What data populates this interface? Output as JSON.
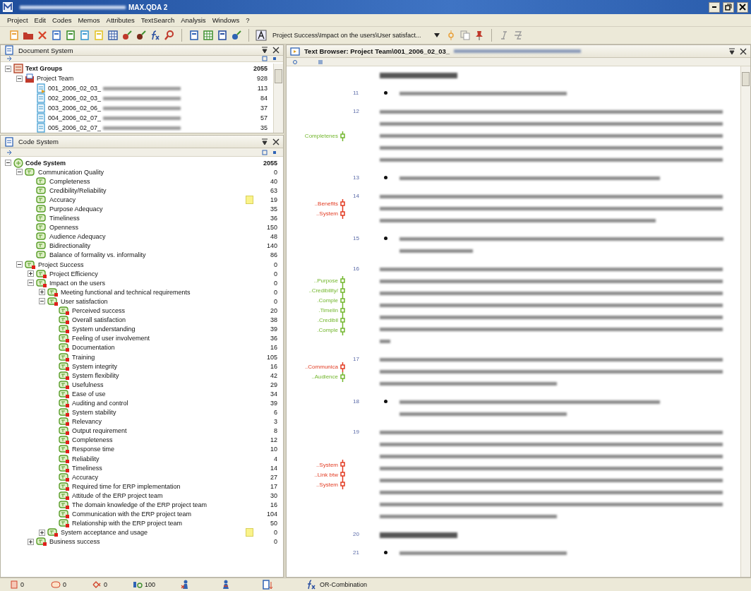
{
  "window": {
    "title": "MAX.QDA 2",
    "title_redacted": true
  },
  "menu": [
    "Project",
    "Edit",
    "Codes",
    "Memos",
    "Attributes",
    "TextSearch",
    "Analysis",
    "Windows",
    "?"
  ],
  "toolbar": {
    "code_path": "Project Success\\Impact on the users\\User satisfact..."
  },
  "document_system": {
    "title": "Document System",
    "nodes": [
      {
        "kind": "root",
        "label": "Text Groups",
        "count": "2055",
        "expanded": true,
        "children": [
          {
            "kind": "group",
            "label": "Project Team",
            "count": "928",
            "expanded": true,
            "children": [
              {
                "kind": "document",
                "label": "001_2006_02_03_",
                "count": "113",
                "active": true,
                "redacted": true
              },
              {
                "kind": "document",
                "label": "002_2006_02_03_",
                "count": "84",
                "active": false,
                "redacted": true
              },
              {
                "kind": "document",
                "label": "003_2006_02_06_",
                "count": "37",
                "active": false,
                "redacted": true
              },
              {
                "kind": "document",
                "label": "004_2006_02_07_",
                "count": "57",
                "active": false,
                "redacted": true
              },
              {
                "kind": "document",
                "label": "005_2006_02_07_",
                "count": "35",
                "active": false,
                "redacted": true
              }
            ]
          }
        ]
      }
    ]
  },
  "code_system": {
    "title": "Code System",
    "nodes": [
      {
        "label": "Code System",
        "count": "2055",
        "expanded": true,
        "children": [
          {
            "label": "Communication Quality",
            "count": "0",
            "expanded": true,
            "marked": false,
            "memo": false,
            "children": [
              {
                "label": "Completeness",
                "count": "40",
                "marked": false,
                "memo": false
              },
              {
                "label": "Credibility/Reliability",
                "count": "63",
                "marked": false,
                "memo": false
              },
              {
                "label": "Accuracy",
                "count": "19",
                "marked": false,
                "memo": true
              },
              {
                "label": "Purpose Adequacy",
                "count": "35",
                "marked": false,
                "memo": false
              },
              {
                "label": "Timeliness",
                "count": "36",
                "marked": false,
                "memo": false
              },
              {
                "label": "Openness",
                "count": "150",
                "marked": false,
                "memo": false
              },
              {
                "label": "Audience Adequacy",
                "count": "48",
                "marked": false,
                "memo": false
              },
              {
                "label": "Bidirectionality",
                "count": "140",
                "marked": false,
                "memo": false
              },
              {
                "label": "Balance of formality vs. informality",
                "count": "86",
                "marked": false,
                "memo": false
              }
            ]
          },
          {
            "label": "Project Success",
            "count": "0",
            "expanded": true,
            "marked": true,
            "memo": false,
            "children": [
              {
                "label": "Project Efficiency",
                "count": "0",
                "expanded": false,
                "marked": true,
                "memo": false
              },
              {
                "label": "Impact on the users",
                "count": "0",
                "expanded": true,
                "marked": true,
                "memo": false,
                "children": [
                  {
                    "label": "Meeting functional and technical requirements",
                    "count": "0",
                    "expanded": false,
                    "marked": true,
                    "memo": false
                  },
                  {
                    "label": "User satisfaction",
                    "count": "0",
                    "expanded": true,
                    "marked": true,
                    "memo": false,
                    "children": [
                      {
                        "label": "Perceived success",
                        "count": "20",
                        "marked": true,
                        "memo": false
                      },
                      {
                        "label": "Overall satisfaction",
                        "count": "38",
                        "marked": true,
                        "memo": false
                      },
                      {
                        "label": "System understanding",
                        "count": "39",
                        "marked": true,
                        "memo": false
                      },
                      {
                        "label": "Feeling of user involvement",
                        "count": "36",
                        "marked": true,
                        "memo": false
                      },
                      {
                        "label": "Documentation",
                        "count": "16",
                        "marked": true,
                        "memo": false
                      },
                      {
                        "label": "Training",
                        "count": "105",
                        "marked": true,
                        "memo": false
                      },
                      {
                        "label": "System integrity",
                        "count": "16",
                        "marked": true,
                        "memo": false
                      },
                      {
                        "label": "System flexibility",
                        "count": "42",
                        "marked": true,
                        "memo": false
                      },
                      {
                        "label": "Usefulness",
                        "count": "29",
                        "marked": true,
                        "memo": false
                      },
                      {
                        "label": "Ease of use",
                        "count": "34",
                        "marked": true,
                        "memo": false
                      },
                      {
                        "label": "Auditing and control",
                        "count": "39",
                        "marked": true,
                        "memo": false
                      },
                      {
                        "label": "System stability",
                        "count": "6",
                        "marked": true,
                        "memo": false
                      },
                      {
                        "label": "Relevancy",
                        "count": "3",
                        "marked": true,
                        "memo": false
                      },
                      {
                        "label": "Output requirement",
                        "count": "8",
                        "marked": true,
                        "memo": false
                      },
                      {
                        "label": "Completeness",
                        "count": "12",
                        "marked": true,
                        "memo": false
                      },
                      {
                        "label": "Response time",
                        "count": "10",
                        "marked": true,
                        "memo": false
                      },
                      {
                        "label": "Reliability",
                        "count": "4",
                        "marked": true,
                        "memo": false
                      },
                      {
                        "label": "Timeliness",
                        "count": "14",
                        "marked": true,
                        "memo": false
                      },
                      {
                        "label": "Accuracy",
                        "count": "27",
                        "marked": true,
                        "memo": false
                      },
                      {
                        "label": "Required time for ERP implementation",
                        "count": "17",
                        "marked": true,
                        "memo": false
                      },
                      {
                        "label": "Attitude of the ERP project team",
                        "count": "30",
                        "marked": true,
                        "memo": false
                      },
                      {
                        "label": "The domain knowledge of the ERP project team",
                        "count": "16",
                        "marked": true,
                        "memo": false
                      },
                      {
                        "label": "Communication with the ERP project team",
                        "count": "104",
                        "marked": true,
                        "memo": false
                      },
                      {
                        "label": "Relationship with the ERP project team",
                        "count": "50",
                        "marked": true,
                        "memo": false
                      }
                    ]
                  },
                  {
                    "label": "System acceptance and usage",
                    "count": "0",
                    "expanded": false,
                    "marked": true,
                    "memo": true
                  }
                ]
              },
              {
                "label": "Business success",
                "count": "0",
                "expanded": false,
                "marked": true,
                "memo": false
              }
            ]
          }
        ]
      }
    ]
  },
  "text_browser": {
    "title": "Text Browser: Project Team\\001_2006_02_03_",
    "title_redacted": true,
    "paragraphs": [
      {
        "kind": "heading",
        "lines": [
          {
            "kind": "short"
          }
        ]
      },
      {
        "kind": "bullet",
        "number": "11",
        "lines": [
          {
            "kind": "half"
          }
        ]
      },
      {
        "kind": "text",
        "number": "12",
        "codings": [
          {
            "label": "Completenes",
            "color": "#72b62c"
          }
        ],
        "lines": [
          {
            "kind": "full"
          },
          {
            "kind": "full"
          },
          {
            "kind": "full"
          },
          {
            "kind": "full"
          },
          {
            "kind": "full"
          }
        ]
      },
      {
        "kind": "bullet",
        "number": "13",
        "lines": [
          {
            "kind": "long"
          }
        ]
      },
      {
        "kind": "text",
        "number": "14",
        "codings": [
          {
            "label": "..Benefits",
            "color": "#e23b22"
          },
          {
            "label": "..System",
            "color": "#e23b22"
          }
        ],
        "lines": [
          {
            "kind": "full"
          },
          {
            "kind": "full"
          },
          {
            "kind": "long"
          }
        ]
      },
      {
        "kind": "bullet",
        "number": "15",
        "lines": [
          {
            "kind": "full"
          },
          {
            "kind": "short"
          }
        ]
      },
      {
        "kind": "text",
        "number": "16",
        "codings": [
          {
            "label": "..Purpose",
            "color": "#72b62c"
          },
          {
            "label": "..Credibility/",
            "color": "#72b62c"
          },
          {
            "label": ".Comple",
            "color": "#72b62c"
          },
          {
            "label": ".Timelin",
            "color": "#72b62c"
          },
          {
            "label": ".Credibil",
            "color": "#72b62c"
          },
          {
            "label": ".Comple",
            "color": "#72b62c"
          }
        ],
        "lines": [
          {
            "kind": "full"
          },
          {
            "kind": "full"
          },
          {
            "kind": "full"
          },
          {
            "kind": "full"
          },
          {
            "kind": "full"
          },
          {
            "kind": "full"
          },
          {
            "kind": "tiny"
          }
        ]
      },
      {
        "kind": "text",
        "number": "17",
        "codings": [
          {
            "label": "..Communica",
            "color": "#e23b22"
          },
          {
            "label": "..Audience",
            "color": "#72b62c"
          }
        ],
        "lines": [
          {
            "kind": "full"
          },
          {
            "kind": "full"
          },
          {
            "kind": "half"
          }
        ]
      },
      {
        "kind": "bullet",
        "number": "18",
        "lines": [
          {
            "kind": "long"
          },
          {
            "kind": "half"
          }
        ]
      },
      {
        "kind": "text",
        "number": "19",
        "codings": [
          {
            "label": "..System",
            "color": "#e23b22"
          },
          {
            "label": "..Link btw",
            "color": "#e23b22"
          },
          {
            "label": "..System",
            "color": "#e23b22"
          }
        ],
        "lines": [
          {
            "kind": "full"
          },
          {
            "kind": "full"
          },
          {
            "kind": "full"
          },
          {
            "kind": "full"
          },
          {
            "kind": "full"
          },
          {
            "kind": "full"
          },
          {
            "kind": "full"
          },
          {
            "kind": "half"
          }
        ]
      },
      {
        "kind": "heading",
        "number": "20",
        "lines": [
          {
            "kind": "short"
          }
        ]
      },
      {
        "kind": "bullet",
        "number": "21",
        "lines": [
          {
            "kind": "half"
          }
        ]
      }
    ]
  },
  "status_bar": {
    "documents": "0",
    "memos": "0",
    "links": "0",
    "weight": "100",
    "mode": "OR-Combination"
  }
}
